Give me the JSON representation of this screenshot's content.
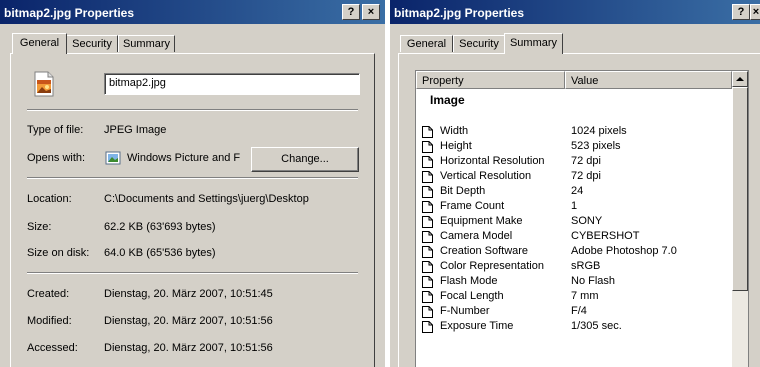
{
  "general_window": {
    "title": "bitmap2.jpg Properties",
    "help_button": "?",
    "close_button": "×",
    "tabs": [
      "General",
      "Security",
      "Summary"
    ],
    "file_name": "bitmap2.jpg",
    "rows": {
      "type_label": "Type of file:",
      "type_value": "JPEG Image",
      "opens_label": "Opens with:",
      "opens_value": "Windows Picture and F",
      "change_button": "Change...",
      "location_label": "Location:",
      "location_value": "C:\\Documents and Settings\\juerg\\Desktop",
      "size_label": "Size:",
      "size_value": "62.2 KB (63'693 bytes)",
      "disk_label": "Size on disk:",
      "disk_value": "64.0 KB (65'536 bytes)",
      "created_label": "Created:",
      "created_value": "Dienstag, 20. März 2007, 10:51:45",
      "modified_label": "Modified:",
      "modified_value": "Dienstag, 20. März 2007, 10:51:56",
      "accessed_label": "Accessed:",
      "accessed_value": "Dienstag, 20. März 2007, 10:51:56"
    }
  },
  "summary_window": {
    "title": "bitmap2.jpg Properties",
    "help_button": "?",
    "close_button": "×",
    "tabs": [
      "General",
      "Security",
      "Summary"
    ],
    "columns": [
      "Property",
      "Value"
    ],
    "group": "Image",
    "properties": [
      {
        "name": "Width",
        "value": "1024 pixels"
      },
      {
        "name": "Height",
        "value": "523 pixels"
      },
      {
        "name": "Horizontal Resolution",
        "value": "72 dpi"
      },
      {
        "name": "Vertical Resolution",
        "value": "72 dpi"
      },
      {
        "name": "Bit Depth",
        "value": "24"
      },
      {
        "name": "Frame Count",
        "value": "1"
      },
      {
        "name": "Equipment Make",
        "value": "SONY"
      },
      {
        "name": "Camera Model",
        "value": "CYBERSHOT"
      },
      {
        "name": "Creation Software",
        "value": "Adobe Photoshop 7.0"
      },
      {
        "name": "Color Representation",
        "value": "sRGB"
      },
      {
        "name": "Flash Mode",
        "value": "No Flash"
      },
      {
        "name": "Focal Length",
        "value": "7 mm"
      },
      {
        "name": "F-Number",
        "value": "F/4"
      },
      {
        "name": "Exposure Time",
        "value": "1/305 sec."
      }
    ]
  },
  "icons": {
    "file": "jpeg-file-icon",
    "app": "picture-viewer-icon",
    "property": "document-icon",
    "scroll_up": "scroll-up-arrow-icon"
  },
  "colors": {
    "titlebar_start": "#0a246a",
    "titlebar_end": "#3a6ea5",
    "face": "#d4d0c8"
  }
}
